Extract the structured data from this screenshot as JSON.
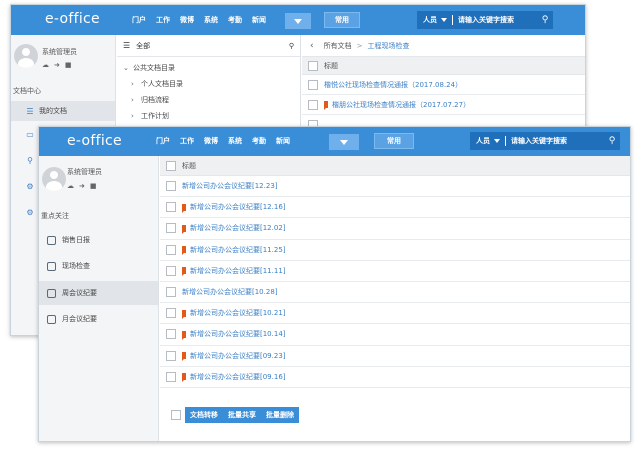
{
  "brand": {
    "logo": "e-office",
    "accent": "#3a8ed8"
  },
  "back_window": {
    "nav": [
      "门户",
      "工作",
      "微博",
      "系统",
      "考勤",
      "新闻"
    ],
    "common_label": "常用",
    "search": {
      "scope": "人员",
      "placeholder": "请输入关键字搜索"
    },
    "user": {
      "name": "系统管理员"
    },
    "section_title": "文档中心",
    "sidebar_items": [
      {
        "label": "我的文档",
        "icon": "list-icon"
      },
      {
        "label": "",
        "icon": "document-icon"
      },
      {
        "label": "",
        "icon": "search-icon"
      },
      {
        "label": "",
        "icon": "gear-icon"
      },
      {
        "label": "",
        "icon": "gear-icon"
      }
    ],
    "tree": {
      "header": "全部",
      "root": "公共文档目录",
      "children": [
        "个人文档目录",
        "归档流程",
        "工作计划"
      ]
    },
    "breadcrumb": [
      "所有文档",
      "工程现场检查"
    ],
    "column_title": "标题",
    "rows": [
      {
        "title": "楷悦公社现场检查情况通报（2017.08.24）",
        "flag": false
      },
      {
        "title": "楷朋公社现场检查情况通报（2017.07.27）",
        "flag": true
      }
    ]
  },
  "front_window": {
    "nav": [
      "门户",
      "工作",
      "微博",
      "系统",
      "考勤",
      "新闻"
    ],
    "common_label": "常用",
    "search": {
      "scope": "人员",
      "placeholder": "请输入关键字搜索"
    },
    "user": {
      "name": "系统管理员"
    },
    "section_title": "重点关注",
    "sidebar_items": [
      {
        "label": "销售日报",
        "active": false
      },
      {
        "label": "现场检查",
        "active": false
      },
      {
        "label": "周会议纪要",
        "active": true
      },
      {
        "label": "月会议纪要",
        "active": false
      }
    ],
    "column_title": "标题",
    "rows": [
      {
        "title": "新增公司办公会议纪要[12.23]",
        "flag": false
      },
      {
        "title": "新增公司办公会议纪要[12.16]",
        "flag": true
      },
      {
        "title": "新增公司办公会议纪要[12.02]",
        "flag": true
      },
      {
        "title": "新增公司办公会议纪要[11.25]",
        "flag": true
      },
      {
        "title": "新增公司办公会议纪要[11.11]",
        "flag": true
      },
      {
        "title": "新增公司办公会议纪要[10.28]",
        "flag": false
      },
      {
        "title": "新增公司办公会议纪要[10.21]",
        "flag": true
      },
      {
        "title": "新增公司办公会议纪要[10.14]",
        "flag": true
      },
      {
        "title": "新增公司办公会议纪要[09.23]",
        "flag": true
      },
      {
        "title": "新增公司办公会议纪要[09.16]",
        "flag": true
      }
    ],
    "actions": [
      "文档转移",
      "批量共享",
      "批量删除"
    ]
  }
}
